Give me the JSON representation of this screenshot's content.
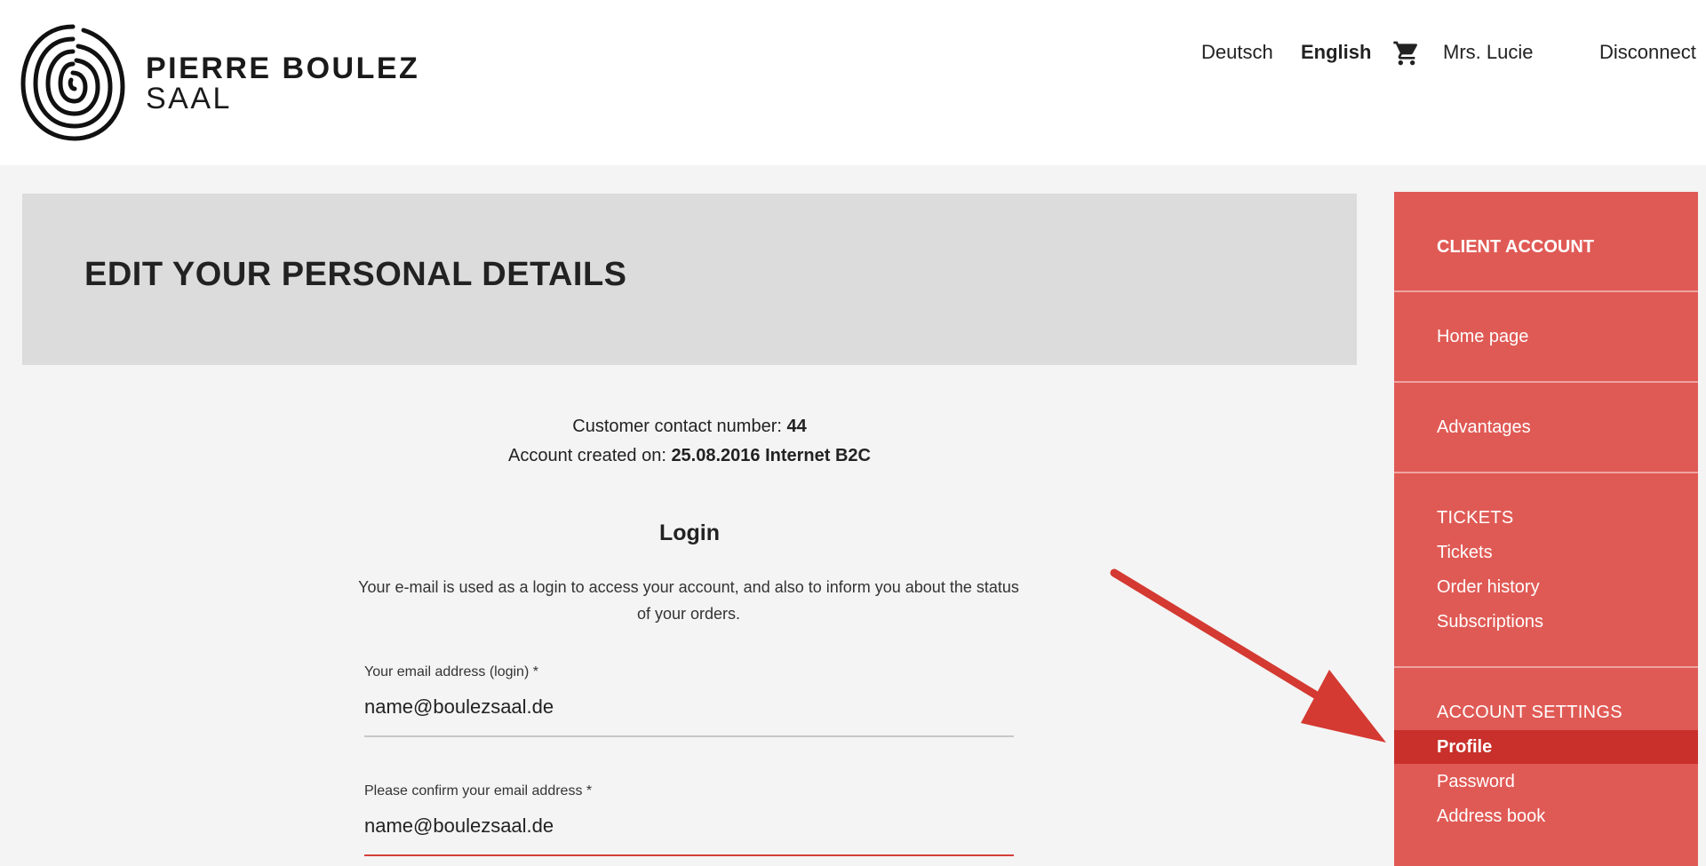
{
  "brand": {
    "line1": "PIERRE BOULEZ",
    "line2": "SAAL"
  },
  "topnav": {
    "lang_de": "Deutsch",
    "lang_en": "English",
    "cart_icon": "shopping-cart-icon",
    "user": "Mrs. Lucie",
    "disconnect": "Disconnect"
  },
  "page": {
    "title": "EDIT YOUR PERSONAL DETAILS"
  },
  "account": {
    "contact_label": "Customer contact number:",
    "contact_value": "44",
    "created_label": "Account created on:",
    "created_value": "25.08.2016 Internet B2C"
  },
  "login": {
    "heading": "Login",
    "description": "Your e-mail is used as a login to access your account, and also to inform you about the status of your orders.",
    "email_label": "Your email address (login)  *",
    "email_value": "name@boulezsaal.de",
    "confirm_label": "Please confirm your email address  *",
    "confirm_value": "name@boulezsaal.de"
  },
  "sidebar": {
    "heading": "CLIENT ACCOUNT",
    "home": "Home page",
    "advantages": "Advantages",
    "tickets_heading": "TICKETS",
    "tickets": "Tickets",
    "order_history": "Order history",
    "subscriptions": "Subscriptions",
    "settings_heading": "ACCOUNT SETTINGS",
    "profile": "Profile",
    "password": "Password",
    "address_book": "Address book"
  },
  "colors": {
    "sidebar_bg": "#e05a55",
    "sidebar_active": "#c9302b",
    "annotation_arrow": "#d43a32"
  }
}
